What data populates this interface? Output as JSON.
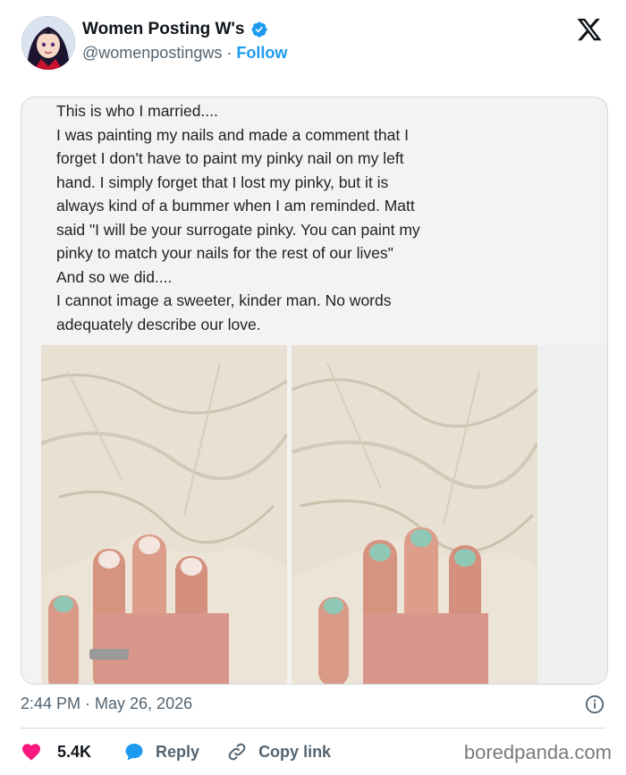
{
  "header": {
    "display_name": "Women Posting W's",
    "handle": "@womenpostingws",
    "separator": "·",
    "follow_label": "Follow"
  },
  "post": {
    "caption_lines": [
      "This is who I married....",
      "I was painting my nails and made a comment that I",
      "forget I don't have to paint my pinky nail on my left",
      "hand.  I simply forget that I lost my pinky, but it is",
      "always kind of a bummer when I am reminded. Matt",
      "said \"I will be your surrogate pinky. You can paint my",
      "pinky to match your nails for the rest of our lives\"",
      "And so we did....",
      "I cannot image a sweeter, kinder man.  No words",
      "adequately describe our love."
    ],
    "timestamp": "2:44 PM · May 26, 2026"
  },
  "actions": {
    "likes": "5.4K",
    "reply_label": "Reply",
    "copy_link_label": "Copy link"
  },
  "watermark": "boredpanda.com",
  "colors": {
    "accent": "#1d9bf0",
    "like": "#f91880",
    "muted": "#536471",
    "nail_polish": "#8fc9b5"
  }
}
